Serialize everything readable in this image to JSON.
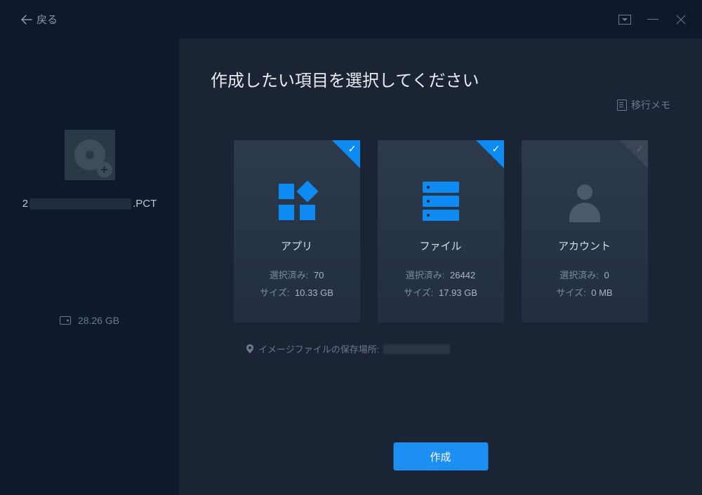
{
  "header": {
    "back_label": "戻る"
  },
  "sidebar": {
    "filename_prefix": "2",
    "filename_suffix": ".PCT",
    "total_size": "28.26 GB"
  },
  "main": {
    "title": "作成したい項目を選択してください",
    "memo_label": "移行メモ",
    "cards": {
      "apps": {
        "label": "アプリ",
        "selected_label": "選択済み:",
        "selected_count": "70",
        "size_label": "サイズ:",
        "size_value": "10.33 GB",
        "checked": true
      },
      "files": {
        "label": "ファイル",
        "selected_label": "選択済み:",
        "selected_count": "26442",
        "size_label": "サイズ:",
        "size_value": "17.93 GB",
        "checked": true
      },
      "account": {
        "label": "アカウント",
        "selected_label": "選択済み:",
        "selected_count": "0",
        "size_label": "サイズ:",
        "size_value": "0 MB",
        "checked": false
      }
    },
    "save_path_label": "イメージファイルの保存場所:",
    "create_button": "作成"
  }
}
